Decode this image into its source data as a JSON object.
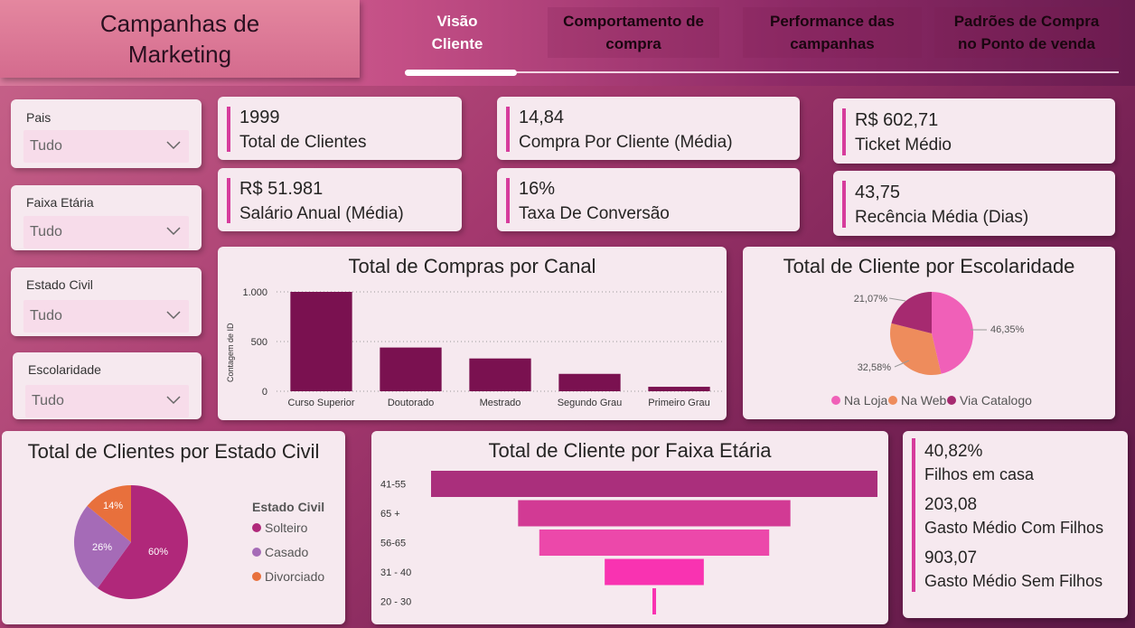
{
  "header": {
    "title_line1": "Campanhas de",
    "title_line2": "Marketing",
    "tabs": [
      {
        "line1": "Visão",
        "line2": "Cliente",
        "active": true
      },
      {
        "line1": "Comportamento de",
        "line2": "compra",
        "active": false
      },
      {
        "line1": "Performance das",
        "line2": "campanhas",
        "active": false
      },
      {
        "line1": "Padrões de Compra",
        "line2": "no Ponto de venda",
        "active": false
      }
    ]
  },
  "filters": [
    {
      "label": "Pais",
      "value": "Tudo"
    },
    {
      "label": "Faixa Etária",
      "value": "Tudo"
    },
    {
      "label": "Estado Civil",
      "value": "Tudo"
    },
    {
      "label": "Escolaridade",
      "value": "Tudo"
    }
  ],
  "kpis": {
    "total_clientes": {
      "value": "1999",
      "label": "Total de Clientes"
    },
    "salario": {
      "value": "R$ 51.981",
      "label": "Salário Anual (Média)"
    },
    "compra_cliente": {
      "value": "14,84",
      "label": "Compra Por Cliente (Média)"
    },
    "conversao": {
      "value": "16%",
      "label": "Taxa De Conversão"
    },
    "ticket": {
      "value": "R$ 602,71",
      "label": "Ticket Médio"
    },
    "recencia": {
      "value": "43,75",
      "label": "Recência Média (Dias)"
    }
  },
  "side_kpis": [
    {
      "value": "40,82%",
      "label": "Filhos em casa"
    },
    {
      "value": "203,08",
      "label": "Gasto Médio Com Filhos"
    },
    {
      "value": "903,07",
      "label": "Gasto Médio Sem Filhos"
    }
  ],
  "colors": {
    "accent": "#d63c9c",
    "bar": "#7a1150",
    "pie_pink": "#f060b8",
    "pie_orange": "#ee8c5c",
    "pie_plum": "#a62a70",
    "civil_solteiro": "#b0287a",
    "civil_casado": "#a56bb7",
    "civil_divorciado": "#e8703c",
    "funnel": [
      "#aa2f7c",
      "#d23a94",
      "#ec48aa",
      "#f933b1",
      "#f933b1"
    ]
  },
  "chart_data": [
    {
      "type": "bar",
      "title": "Total de Compras por Canal",
      "ylabel": "Contagem de ID",
      "categories": [
        "Curso Superior",
        "Doutorado",
        "Mestrado",
        "Segundo Grau",
        "Primeiro Grau"
      ],
      "values": [
        1000,
        440,
        330,
        175,
        45
      ],
      "yticks": [
        "1.000",
        "500",
        "0"
      ],
      "ylim": [
        0,
        1000
      ]
    },
    {
      "type": "pie",
      "title": "Total de Cliente por Escolaridade",
      "labels": [
        "Na Loja",
        "Na Web",
        "Via Catalogo"
      ],
      "values": [
        46.35,
        32.58,
        21.07
      ],
      "value_labels": [
        "46,35%",
        "32,58%",
        "21,07%"
      ],
      "legend_position": "bottom"
    },
    {
      "type": "pie",
      "title": "Total de Clientes por Estado Civil",
      "legend_title": "Estado Civil",
      "labels": [
        "Solteiro",
        "Casado",
        "Divorciado"
      ],
      "values": [
        60,
        26,
        14
      ],
      "value_labels": [
        "60%",
        "26%",
        "14%"
      ],
      "legend_position": "right"
    },
    {
      "type": "bar",
      "orientation": "funnel",
      "title": "Total de Cliente por Faixa Etária",
      "categories": [
        "41-55",
        "65 +",
        "56-65",
        "31 - 40",
        "20 - 30"
      ],
      "values": [
        1000,
        610,
        515,
        222,
        8
      ]
    }
  ]
}
